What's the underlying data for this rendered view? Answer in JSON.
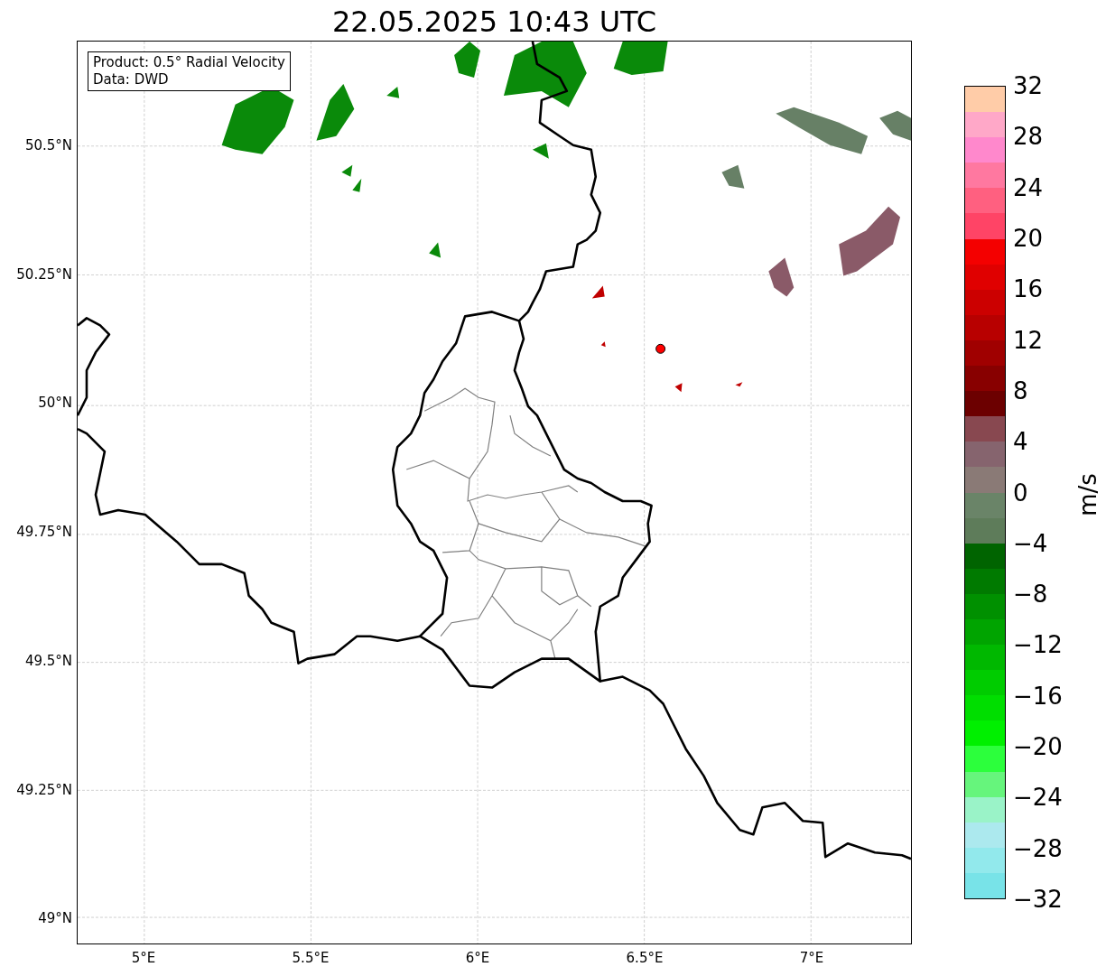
{
  "title": "22.05.2025 10:43 UTC",
  "info_box": {
    "lines": [
      "Product: 0.5° Radial Velocity",
      "Data: DWD"
    ]
  },
  "map": {
    "x_ticks": [
      "5°E",
      "5.5°E",
      "6°E",
      "6.5°E",
      "7°E"
    ],
    "y_ticks": [
      "50.5°N",
      "50.25°N",
      "50°N",
      "49.75°N",
      "49.5°N",
      "49.25°N",
      "49°N"
    ]
  },
  "colorbar": {
    "label": "m/s",
    "ticks": [
      "32",
      "28",
      "24",
      "20",
      "16",
      "12",
      "8",
      "4",
      "0",
      "−4",
      "−8",
      "−12",
      "−16",
      "−20",
      "−24",
      "−28",
      "−32"
    ],
    "bins": [
      {
        "color": "#ffcca8"
      },
      {
        "color": "#ffa8c8"
      },
      {
        "color": "#ff88cc"
      },
      {
        "color": "#ff78a0"
      },
      {
        "color": "#ff6080"
      },
      {
        "color": "#ff4466"
      },
      {
        "color": "#f40000"
      },
      {
        "color": "#e00000"
      },
      {
        "color": "#cc0000"
      },
      {
        "color": "#b80000"
      },
      {
        "color": "#a00000"
      },
      {
        "color": "#880000"
      },
      {
        "color": "#6c0000"
      },
      {
        "color": "#884850"
      },
      {
        "color": "#86646e"
      },
      {
        "color": "#8a7a76"
      },
      {
        "color": "#6a8468"
      },
      {
        "color": "#5e7c5a"
      },
      {
        "color": "#006400"
      },
      {
        "color": "#007a00"
      },
      {
        "color": "#009000"
      },
      {
        "color": "#00a400"
      },
      {
        "color": "#00b800"
      },
      {
        "color": "#00cc00"
      },
      {
        "color": "#00de00"
      },
      {
        "color": "#00f000"
      },
      {
        "color": "#2cff3c"
      },
      {
        "color": "#66f57c"
      },
      {
        "color": "#9af3c8"
      },
      {
        "color": "#ace9ee"
      },
      {
        "color": "#92e9ec"
      },
      {
        "color": "#78e3e8"
      }
    ]
  }
}
